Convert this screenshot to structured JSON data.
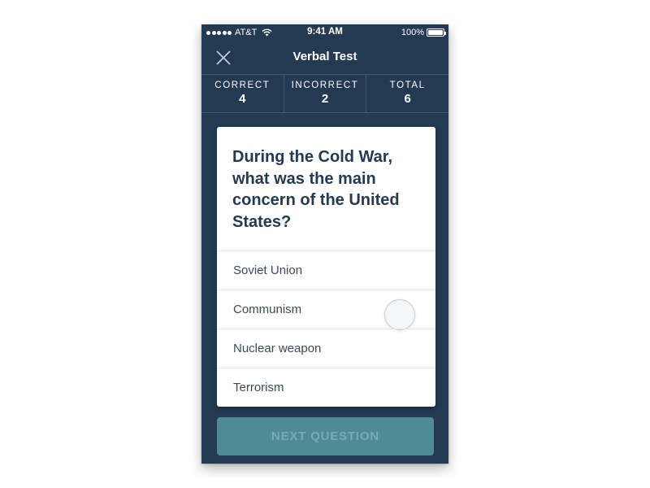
{
  "status_bar": {
    "carrier": "AT&T",
    "time": "9:41 AM",
    "battery": "100%",
    "signal_bars": 5,
    "battery_level": 1.0
  },
  "nav": {
    "title": "Verbal Test",
    "close_icon": "close-icon"
  },
  "stats": [
    {
      "label": "CORRECT",
      "value": "4"
    },
    {
      "label": "INCORRECT",
      "value": "2"
    },
    {
      "label": "TOTAL",
      "value": "6"
    }
  ],
  "question": {
    "text": "During the Cold War, what was the main concern of the United States?",
    "options": [
      {
        "label": "Soviet Union"
      },
      {
        "label": "Communism"
      },
      {
        "label": "Nuclear weapon"
      },
      {
        "label": "Terrorism"
      }
    ]
  },
  "next_button": {
    "label": "NEXT QUESTION"
  },
  "colors": {
    "background": "#243a52",
    "card": "#ffffff",
    "question_text": "#243a52",
    "button": "#4f8a99",
    "button_text": "#7aaab5"
  }
}
